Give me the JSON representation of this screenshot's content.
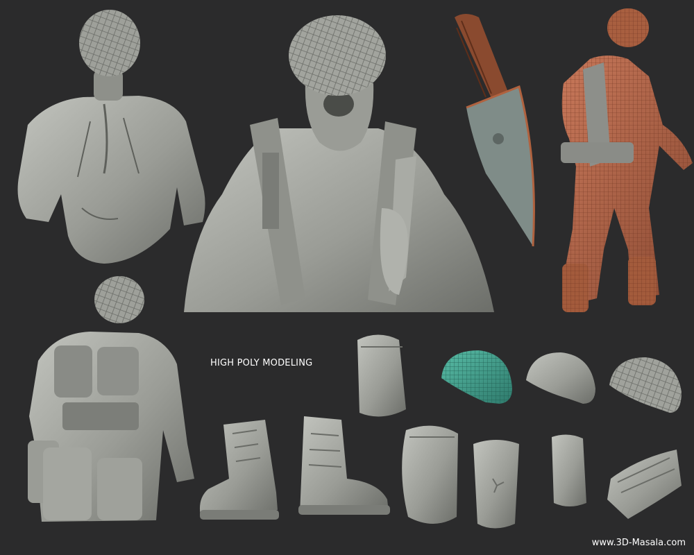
{
  "caption": "HIGH POLY MODELING",
  "watermark": "www.3D-Masala.com",
  "colors": {
    "background": "#2b2b2c",
    "clay": "#9ea09a",
    "clay_dark": "#6f716c",
    "clay_light": "#c4c6c0",
    "wire_orange": "#b0623f",
    "wire_teal": "#3f9c8a",
    "knife_handle": "#8a4a2f"
  }
}
